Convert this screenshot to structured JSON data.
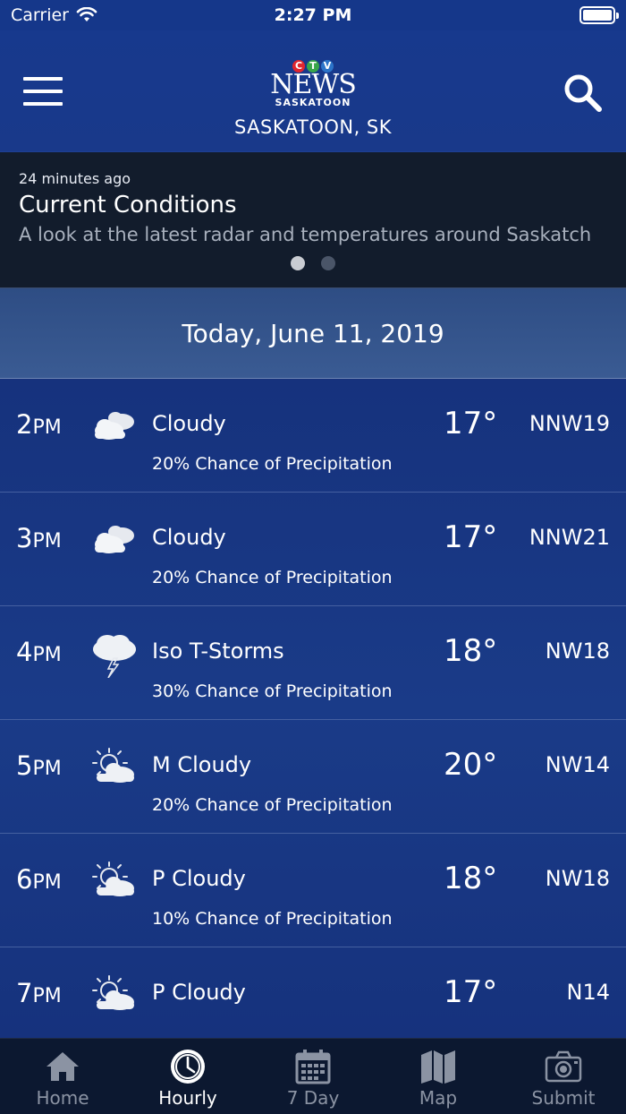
{
  "status": {
    "carrier": "Carrier",
    "time": "2:27 PM"
  },
  "header": {
    "logo_ctv": [
      "C",
      "T",
      "V"
    ],
    "logo_news": "NEWS",
    "logo_city": "SASKATOON",
    "location": "SASKATOON, SK"
  },
  "banner": {
    "time": "24 minutes ago",
    "title": "Current Conditions",
    "description": "A look at the latest radar and temperatures around Saskatch..."
  },
  "date_label": "Today, June 11, 2019",
  "hours": [
    {
      "hour": "2",
      "ampm": "PM",
      "icon": "cloudy-icon",
      "condition": "Cloudy",
      "temp": "17°",
      "wind": "NNW19",
      "precip": "20% Chance of Precipitation"
    },
    {
      "hour": "3",
      "ampm": "PM",
      "icon": "cloudy-icon",
      "condition": "Cloudy",
      "temp": "17°",
      "wind": "NNW21",
      "precip": "20% Chance of Precipitation"
    },
    {
      "hour": "4",
      "ampm": "PM",
      "icon": "thunderstorm-icon",
      "condition": "Iso T-Storms",
      "temp": "18°",
      "wind": "NW18",
      "precip": "30% Chance of Precipitation"
    },
    {
      "hour": "5",
      "ampm": "PM",
      "icon": "sun-cloud-icon",
      "condition": "M Cloudy",
      "temp": "20°",
      "wind": "NW14",
      "precip": "20% Chance of Precipitation"
    },
    {
      "hour": "6",
      "ampm": "PM",
      "icon": "sun-cloud-icon",
      "condition": "P Cloudy",
      "temp": "18°",
      "wind": "NW18",
      "precip": "10% Chance of Precipitation"
    },
    {
      "hour": "7",
      "ampm": "PM",
      "icon": "sun-cloud-icon",
      "condition": "P Cloudy",
      "temp": "17°",
      "wind": "N14",
      "precip": ""
    }
  ],
  "tabs": [
    {
      "label": "Home",
      "icon": "home-icon",
      "active": false
    },
    {
      "label": "Hourly",
      "icon": "clock-icon",
      "active": true
    },
    {
      "label": "7 Day",
      "icon": "calendar-icon",
      "active": false
    },
    {
      "label": "Map",
      "icon": "map-icon",
      "active": false
    },
    {
      "label": "Submit",
      "icon": "camera-icon",
      "active": false
    }
  ],
  "colors": {
    "header": "#17398d",
    "banner": "#121c2c",
    "tab_bar": "#0c1830",
    "ctv_red": "#e0262f",
    "ctv_green": "#3aa64a",
    "ctv_blue": "#2b74c9"
  }
}
